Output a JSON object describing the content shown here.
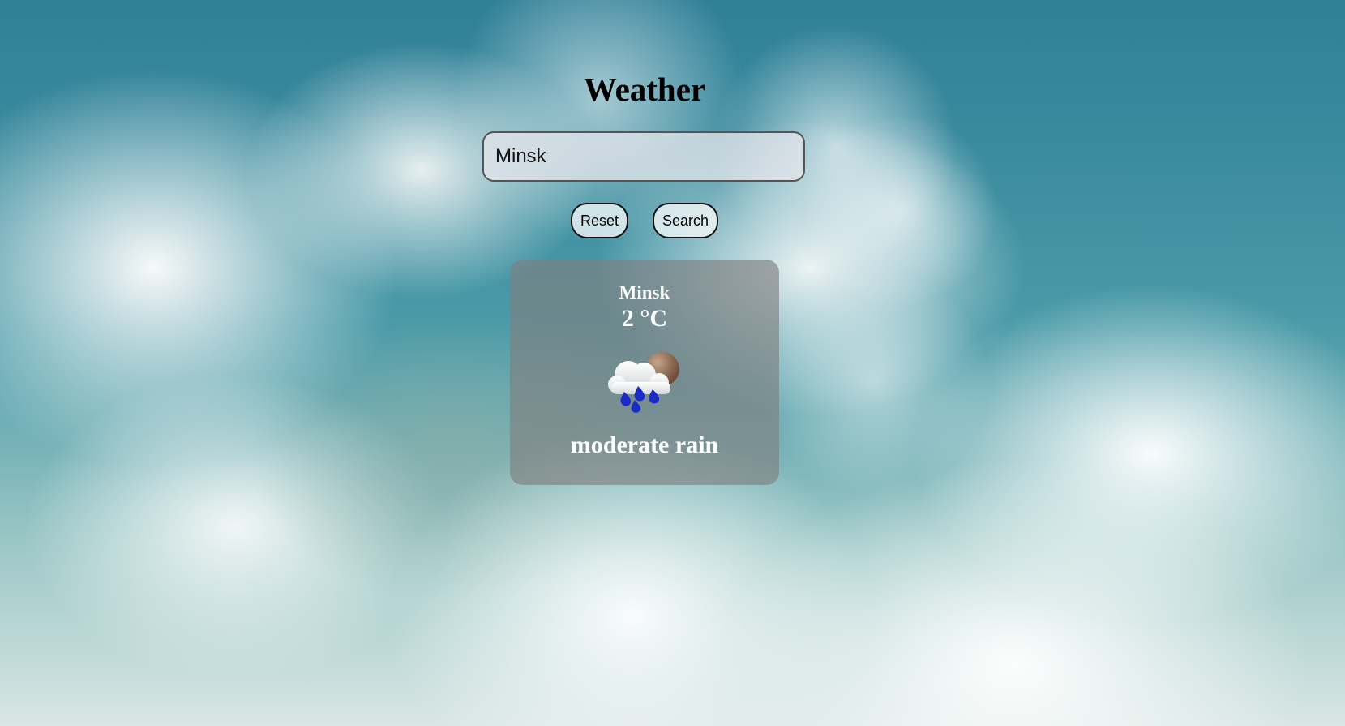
{
  "app": {
    "title": "Weather"
  },
  "search": {
    "value": "Minsk",
    "placeholder": ""
  },
  "buttons": {
    "reset_label": "Reset",
    "search_label": "Search"
  },
  "weather": {
    "city": "Minsk",
    "temperature": "2 °C",
    "description": "moderate rain",
    "icon": "moderate-rain-icon"
  },
  "colors": {
    "card_background": "#808080",
    "text_light": "#ffffff",
    "rain_drop": "#1a2cc5"
  }
}
